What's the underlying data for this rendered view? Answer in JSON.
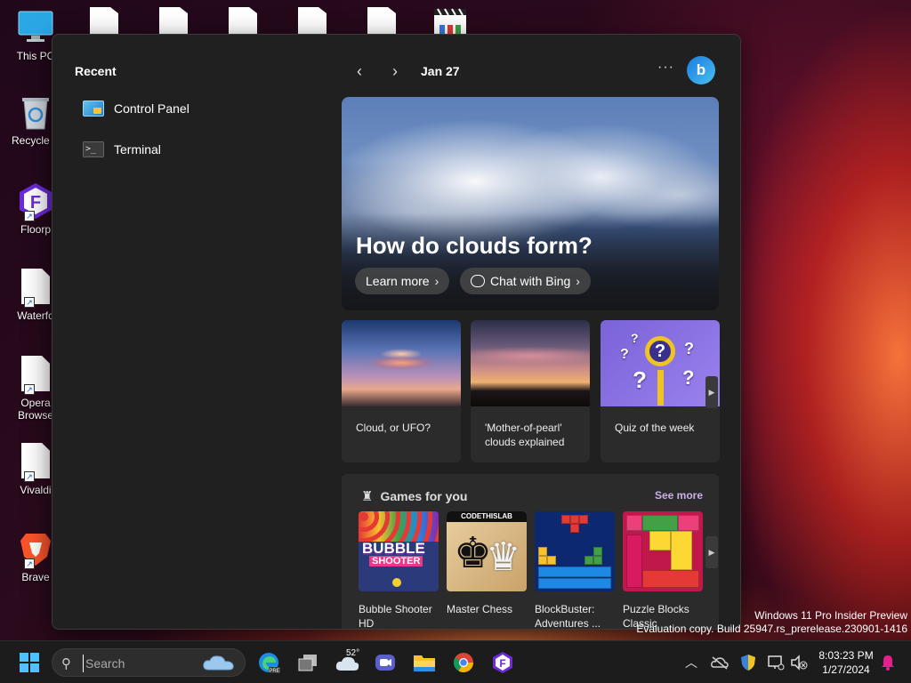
{
  "desktop": {
    "icons": [
      {
        "label": "This PC"
      },
      {
        "label": "Recycle B"
      },
      {
        "label": "Floorp"
      },
      {
        "label": "Waterfo"
      },
      {
        "label": "Opera Browse"
      },
      {
        "label": "Vivaldi"
      },
      {
        "label": "Brave"
      }
    ]
  },
  "widgets": {
    "recent_title": "Recent",
    "recent_items": [
      {
        "label": "Control Panel",
        "icon": "control-panel-icon"
      },
      {
        "label": "Terminal",
        "icon": "terminal-icon"
      }
    ],
    "date": "Jan 27",
    "more_label": "···",
    "bing_label": "b",
    "hero": {
      "title": "How do clouds form?",
      "learn_more": "Learn more",
      "chat_with_bing": "Chat with Bing"
    },
    "cards": [
      {
        "title": "Cloud, or UFO?"
      },
      {
        "title": "'Mother-of-pearl' clouds explained"
      },
      {
        "title": "Quiz of the week"
      }
    ],
    "games": {
      "title": "Games for you",
      "see_more": "See more",
      "items": [
        {
          "name": "Bubble Shooter HD",
          "thumb_word": "BUBBLE",
          "thumb_word2": "SHOOTER"
        },
        {
          "name": "Master Chess",
          "thumb_brand": "CODETHISLAB"
        },
        {
          "name": "BlockBuster: Adventures ..."
        },
        {
          "name": "Puzzle Blocks Classic"
        }
      ]
    }
  },
  "watermark": {
    "line1": "Windows 11 Pro Insider Preview",
    "line2": "Evaluation copy. Build 25947.rs_prerelease.230901-1416"
  },
  "taskbar": {
    "search_placeholder": "Search",
    "weather_temp": "52°",
    "time": "8:03:23 PM",
    "date": "1/27/2024",
    "accent_color": "#4cc2ff"
  }
}
